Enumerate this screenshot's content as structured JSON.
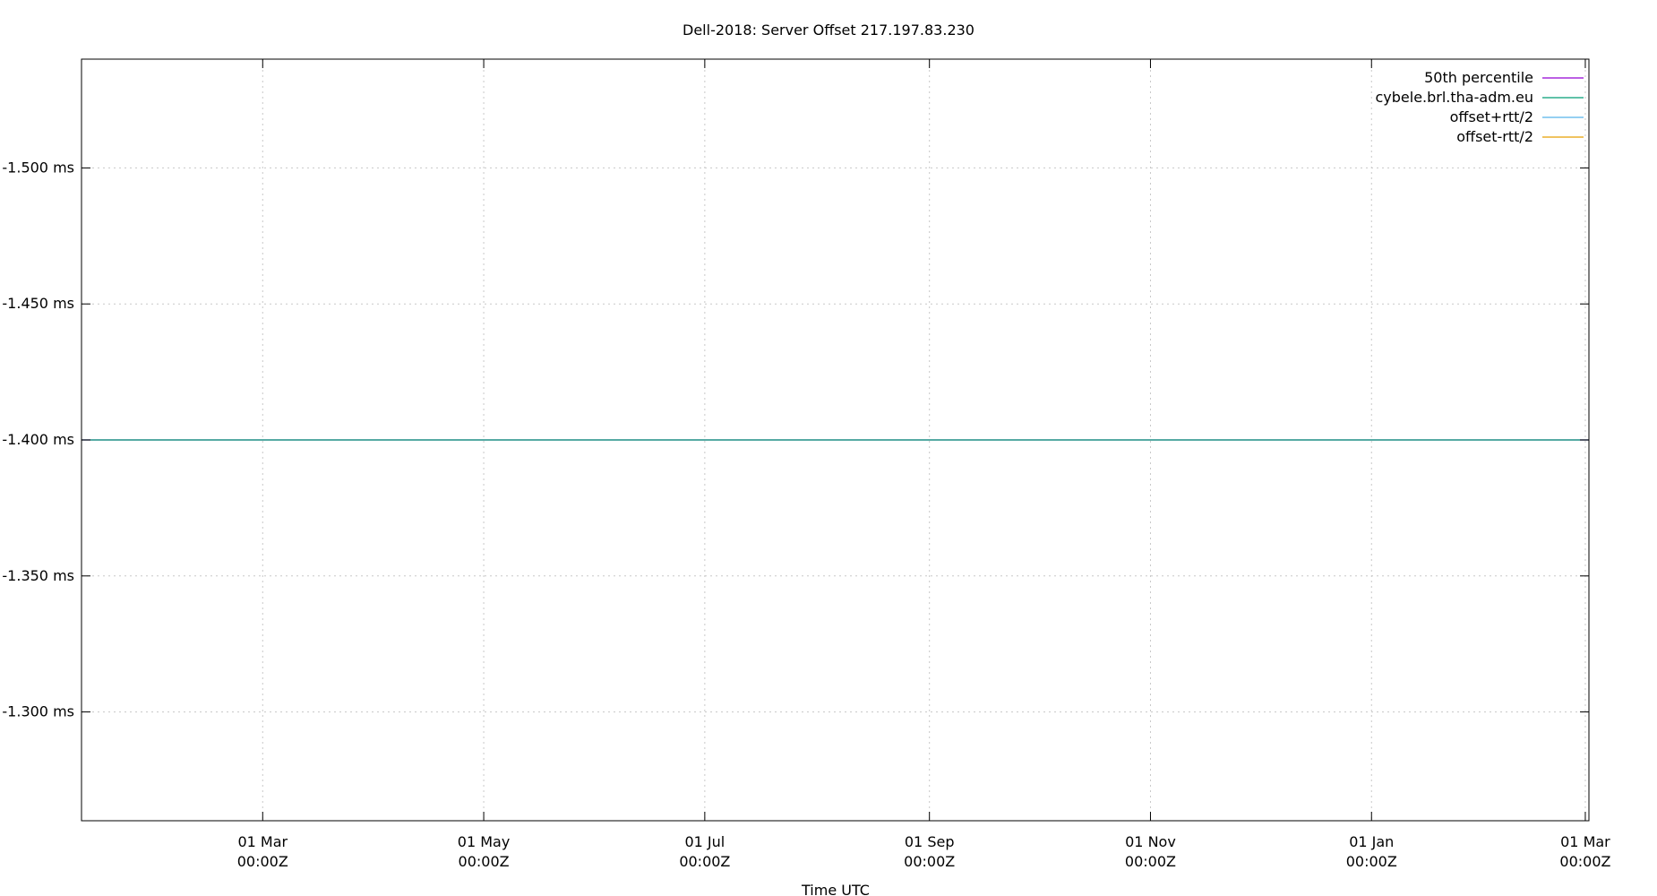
{
  "chart_data": {
    "type": "line",
    "title": "Dell-2018: Server Offset 217.197.83.230",
    "xlabel": "Time UTC",
    "ylabel": "",
    "y_reversed": true,
    "ylim": [
      -1.54,
      -1.26
    ],
    "yticks": [
      {
        "value": -1.5,
        "label": "-1.500 ms"
      },
      {
        "value": -1.45,
        "label": "-1.450 ms"
      },
      {
        "value": -1.4,
        "label": "-1.400 ms"
      },
      {
        "value": -1.35,
        "label": "-1.350 ms"
      },
      {
        "value": -1.3,
        "label": "-1.300 ms"
      }
    ],
    "xlim": [
      "2018-01-10",
      "2019-03-02"
    ],
    "xticks": [
      {
        "date": "2018-03-01",
        "line1": "01 Mar",
        "line2": "00:00Z"
      },
      {
        "date": "2018-05-01",
        "line1": "01 May",
        "line2": "00:00Z"
      },
      {
        "date": "2018-07-01",
        "line1": "01 Jul",
        "line2": "00:00Z"
      },
      {
        "date": "2018-09-01",
        "line1": "01 Sep",
        "line2": "00:00Z"
      },
      {
        "date": "2018-11-01",
        "line1": "01 Nov",
        "line2": "00:00Z"
      },
      {
        "date": "2019-01-01",
        "line1": "01 Jan",
        "line2": "00:00Z"
      },
      {
        "date": "2019-03-01",
        "line1": "01 Mar",
        "line2": "00:00Z"
      }
    ],
    "grid": true,
    "legend_position": "top-right",
    "series": [
      {
        "name": "50th percentile",
        "color": "#9400d3",
        "x": [
          "2018-01-10",
          "2019-03-02"
        ],
        "values": [
          -1.4,
          -1.4
        ]
      },
      {
        "name": "cybele.brl.tha-adm.eu",
        "color": "#009e73",
        "x": [
          "2018-01-10",
          "2019-03-02"
        ],
        "values": [
          -1.4,
          -1.4
        ]
      },
      {
        "name": "offset+rtt/2",
        "color": "#56b4e9",
        "x": [],
        "values": []
      },
      {
        "name": "offset-rtt/2",
        "color": "#e69f00",
        "x": [],
        "values": []
      }
    ]
  }
}
